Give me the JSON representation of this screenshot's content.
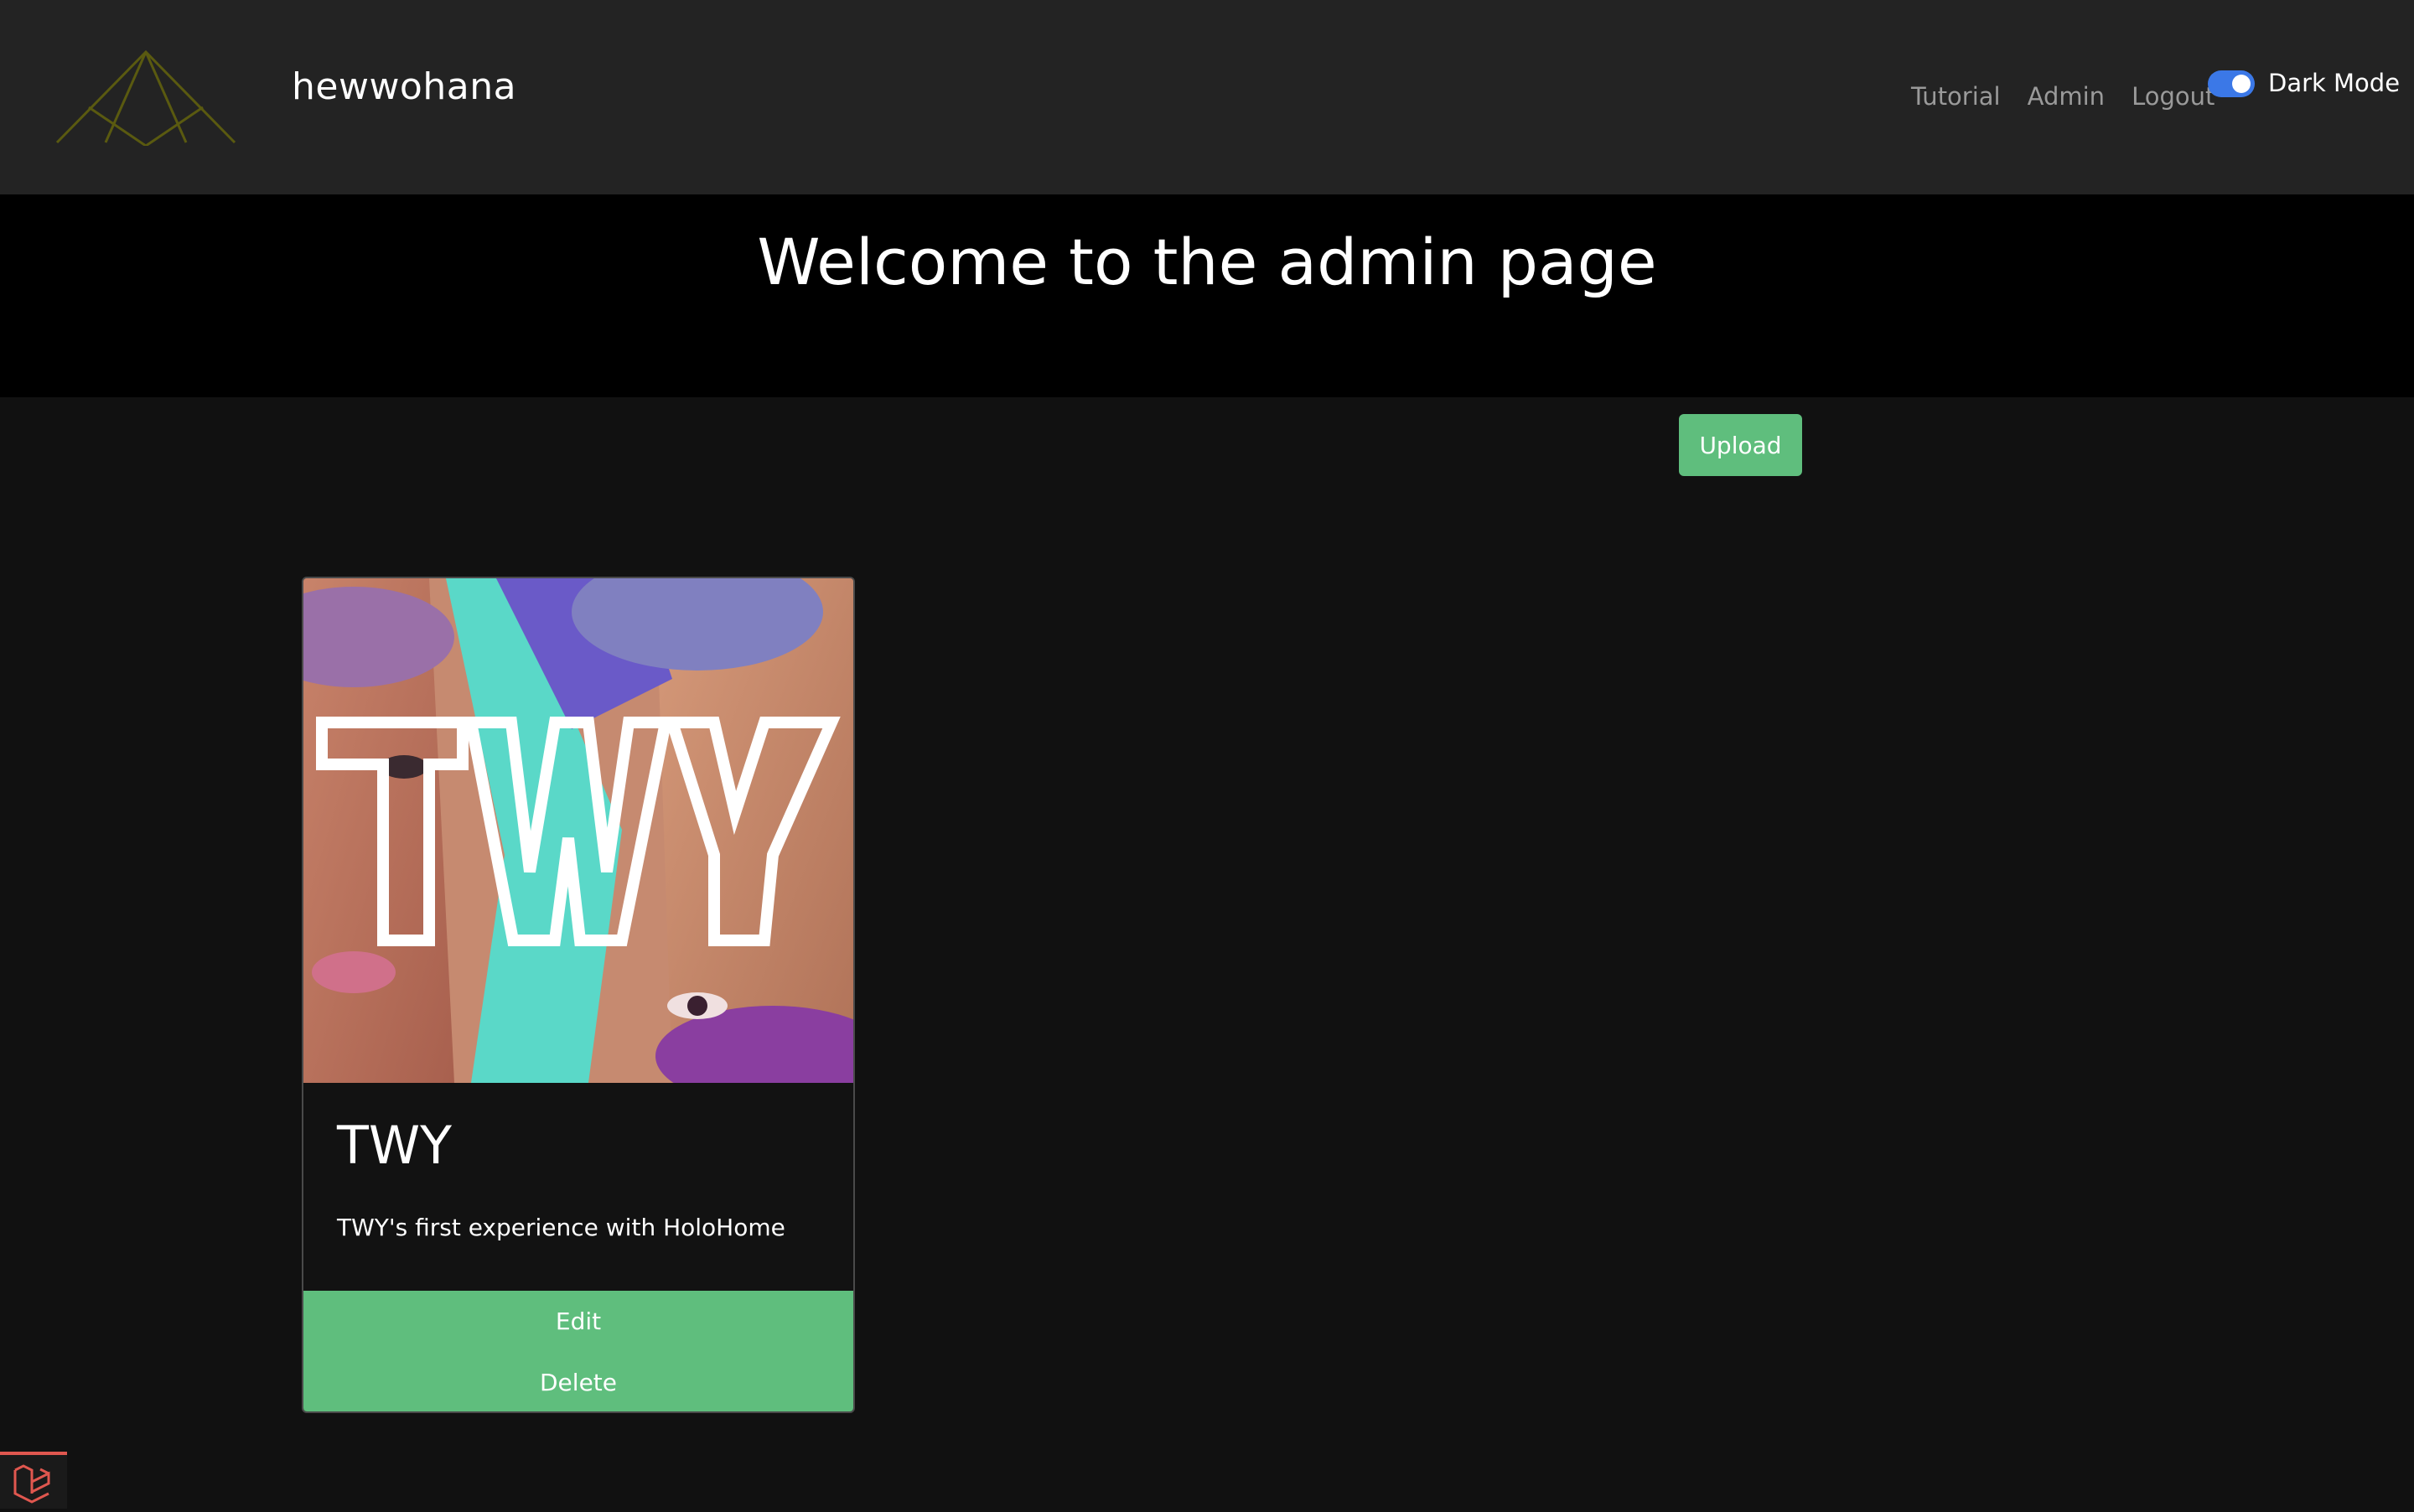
{
  "navbar": {
    "brand": "hewwohana",
    "links": [
      "Tutorial",
      "Admin",
      "Logout"
    ],
    "dark_mode_label": "Dark Mode",
    "dark_mode_on": true
  },
  "hero": {
    "title": "Welcome to the admin page"
  },
  "actions": {
    "upload_label": "Upload"
  },
  "cards": [
    {
      "image_text": "TWY",
      "title": "TWY",
      "description": "TWY's first experience with HoloHome",
      "edit_label": "Edit",
      "delete_label": "Delete"
    }
  ],
  "colors": {
    "accent_green": "#5fbe7d",
    "toggle_blue": "#3b78e7",
    "navbar_bg": "#232323",
    "page_bg": "#111111"
  }
}
